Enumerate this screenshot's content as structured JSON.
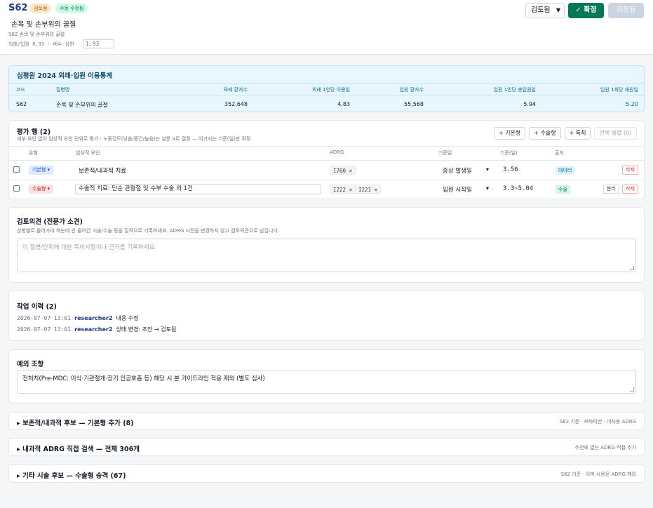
{
  "header": {
    "code": "S62",
    "badge_reviewed": "검토됨",
    "badge_manual": "수동 수정됨",
    "title": "손목 및 손부위의 골절",
    "subtitle": "S62 손목 및 손부위의 골절",
    "ratio_label": "외래/입원 0.93 · 배수 상한",
    "ratio_value": "1.93",
    "status_value": "검토됨",
    "confirm_label": "✓ 확정",
    "save_label": "저장됨"
  },
  "stats": {
    "title": "심평원 2024 외래·입원 이용통계",
    "columns": [
      "코드",
      "질병명",
      "외래 환자수",
      "외래 1인당 이용일",
      "입원 환자수",
      "입원 1인당 총입원일",
      "입원 1회당 재원일"
    ],
    "row": [
      "S62",
      "손목 및 손부위의 골절",
      "352,648",
      "4.83",
      "55,568",
      "5.94",
      "5.20"
    ]
  },
  "eval": {
    "title": "평가 행 (2)",
    "desc": "세부 요인 없이 임상적 요인 단위로 평가 · 노동강도(낮음/중간/높음)는 설문 α로 결정 — 여기서는 기준(일)만 확정",
    "btn_basic": "+ 기본형",
    "btn_surg": "+ 수술형",
    "btn_special": "+ 특칙",
    "btn_merge": "선택 병합 (0)",
    "columns": {
      "type": "유형",
      "factor": "임상적 요인",
      "adrg": "ADRG",
      "date": "기준일",
      "days": "기준(일)",
      "source": "출처"
    },
    "rows": [
      {
        "type": "기본형",
        "factor": "보존적/내과적 치료",
        "adrg": [
          "I760"
        ],
        "date": "증상 발생일",
        "days": "3.56",
        "source": "데이터",
        "delete": "삭제"
      },
      {
        "type": "수술형",
        "factor": "수술적 치료: 단순 관혈절 및 수부 수술 외 1건",
        "adrg": [
          "I222",
          "I221"
        ],
        "date": "입원 시작일",
        "days": "3.3~5.04",
        "source": "수술",
        "split": "분리",
        "delete": "삭제"
      }
    ]
  },
  "review": {
    "title": "검토의견 (전문가 소견)",
    "desc": "상병별로 들어가야 하는데 안 들어간 시술/수술 등을 질적으로 기록하세요. ADRG 사전을 변경하지 않고 검토의견으로 남깁니다.",
    "placeholder": "이 질병/단위에 대한 특이사항이나 근거를 기록하세요."
  },
  "history": {
    "title": "작업 이력 (2)",
    "items": [
      {
        "ts": "2026-07-07 13:01",
        "user": "researcher2",
        "action": "내용 수정"
      },
      {
        "ts": "2026-07-07 13:01",
        "user": "researcher2",
        "action": "상태 변경: 조안 → 검토됨"
      }
    ]
  },
  "exception": {
    "title": "예외 조항",
    "text": "전처치(Pre-MDC: 이식·기관절개·장기 인공호흡 등) 해당 시 본 가이드라인 적용 제외 (별도 심사)"
  },
  "collapsibles": [
    {
      "title": "▸  보존적/내과적 후보 — 기본형 추가 (8)",
      "hint": "S62 기준 · M파티션 · 미사용 ADRG"
    },
    {
      "title": "▸  내과적 ADRG 직접 검색 — 전체 306개",
      "hint": "추천에 없는 ADRG 직접 추가"
    },
    {
      "title": "▸  기타 시술 후보 — 수술형 승격 (67)",
      "hint": "S62 기준 · 이미 사용된 ADRG 제외"
    }
  ]
}
